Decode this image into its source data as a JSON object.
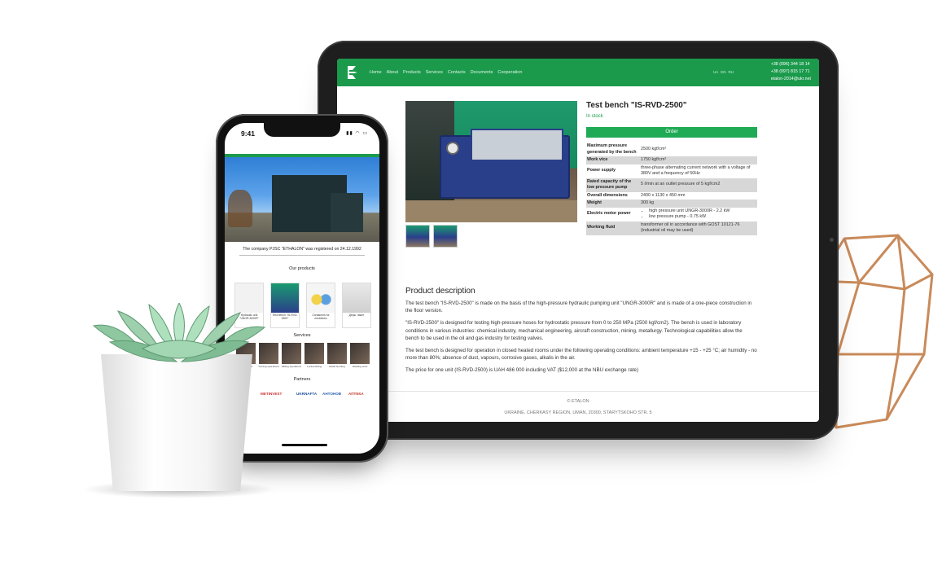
{
  "tablet": {
    "nav": {
      "items": [
        "Home",
        "About",
        "Products",
        "Services",
        "Contacts",
        "Documents",
        "Cooperation"
      ],
      "languages": [
        "UA",
        "EN",
        "RU"
      ],
      "phone1": "+38 (096) 344 18 14",
      "phone2": "+38 (097) 815 17 71",
      "email": "etalon-2014@ukr.net"
    },
    "product": {
      "title": "Test bench \"IS-RVD-2500\"",
      "stock": "In stock",
      "order_label": "Order",
      "specs": [
        {
          "key": "Maximum pressure generated by the bench",
          "value": "2500 kgf/cm²",
          "shade": false
        },
        {
          "key": "Work vice",
          "value": "1750 kgf/cm²",
          "shade": true
        },
        {
          "key": "Power supply",
          "value": "three-phase alternating current network with a voltage of 380V and a frequency of 50Hz",
          "shade": false
        },
        {
          "key": "Rated capacity of the low pressure pump",
          "value": "5 l/min at an outlet pressure of 5 kgf/cm2",
          "shade": true
        },
        {
          "key": "Overall dimensions",
          "value": "2400 x 1130 x 450 mm",
          "shade": false
        },
        {
          "key": "Weight",
          "value": "300 kg",
          "shade": true
        },
        {
          "key": "Electric motor power",
          "value_list": [
            "high pressure unit UNGR-3000R - 2.2 kW",
            "low pressure pump - 0.75 kW"
          ],
          "shade": false
        },
        {
          "key": "Working fluid",
          "value": "transformer oil in accordance with GOST 10121-76 (industrial oil may be used)",
          "shade": true
        }
      ]
    },
    "description": {
      "title": "Product description",
      "paragraphs": [
        "The test bench \"IS-RVD-2500\" is made on the basis of the high-pressure hydraulic pumping unit \"UNGR-3000R\" and is made of a one-piece construction in the floor version.",
        "\"IS-RVD-2500\" is designed for testing high-pressure hoses for hydrostatic pressure from 0 to 250 MPa (2500 kgf/cm2). The bench is used in laboratory conditions in various industries: chemical industry, mechanical engineering, aircraft construction, mining, metallurgy. Technological capabilities allow the bench to be used in the oil and gas industry for testing valves.",
        "The test bench is designed for operation in closed heated rooms under the following operating conditions: ambient temperature +15 - +25 °C; air humidity - no more than 80%; absence of dust, vapours, corrosive gases, alkalis in the air.",
        "The price for one unit (IS-RVD-2500) is UAH 486 000 including VAT ($12,000 at the NBU exchange rate)"
      ]
    },
    "footer": {
      "copyright": "© ETALON",
      "address": "UKRAINE, CHERKASY REGION, UMAN, 20300, STARYTSKOHO STR. 5"
    }
  },
  "phone": {
    "time": "9:41",
    "registration": "The company PJSC \"ETHALON\" was registered on 24.12.1992",
    "products_title": "Our products",
    "products": [
      "Hydraulic unit \"UNGR-3000R\"",
      "Test bench \"IS-RVD-2500\"",
      "Containers for medicines",
      "Держ. пакет"
    ],
    "services_title": "Services",
    "services": [
      "Lathe works",
      "Turning operations",
      "Milling operations",
      "Locksmithing",
      "Metal bending",
      "Welding work"
    ],
    "partners_title": "Partners",
    "partners": [
      "mpv",
      "METINVEST",
      "UKRNAFTA",
      "АНТОНОВ",
      "АПТЕКА"
    ]
  },
  "colors": {
    "brand_green": "#1b9a4c",
    "button_green": "#1faa55",
    "device_frame": "#1e1e1e",
    "copper_frame": "#c98a5a"
  },
  "icons": {
    "logo": "etalon-e-arrow-logo"
  }
}
